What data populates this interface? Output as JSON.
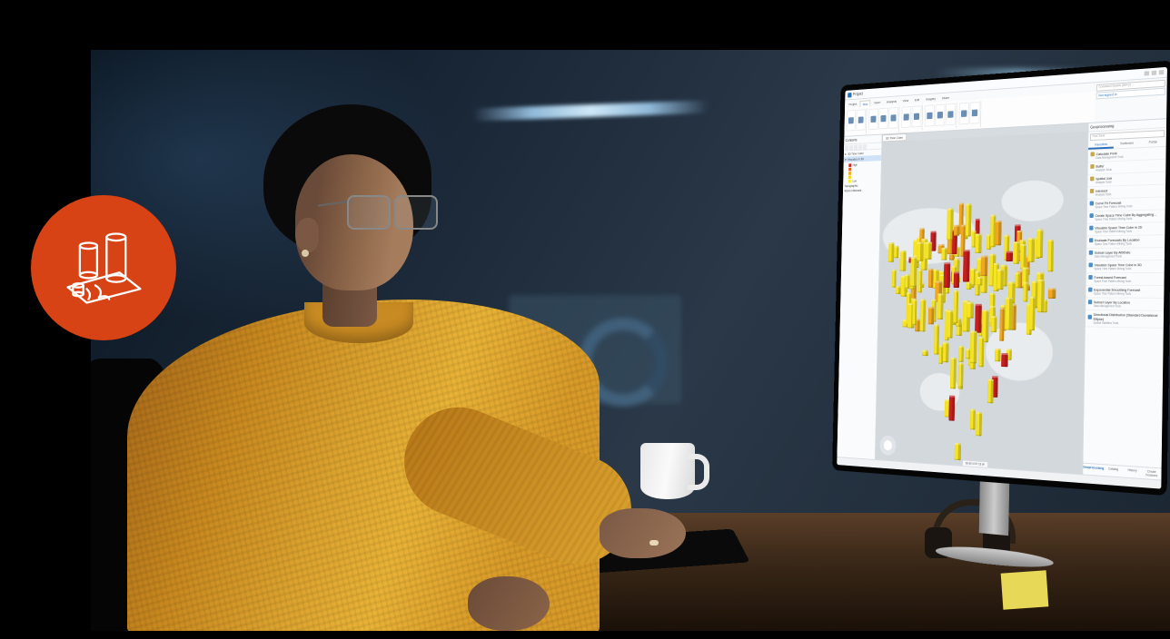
{
  "badge": {
    "color": "#d84316",
    "icon": "3d-cylinders-on-map-icon"
  },
  "monitor_app": {
    "title": "Project",
    "search_placeholder": "Command Search (Alt+Q)",
    "signin_label": "Not signed in",
    "ribbon_tabs": [
      "Project",
      "Map",
      "Insert",
      "Analysis",
      "View",
      "Edit",
      "Imagery",
      "Share"
    ],
    "active_ribbon_tab": "Map",
    "contents": {
      "title": "Contents",
      "scene_name": "3D Time Cube",
      "layer_name": "Visualize in 3D",
      "legend": [
        {
          "color": "#c81e1e",
          "label": "High"
        },
        {
          "color": "#e85a1e",
          "label": ""
        },
        {
          "color": "#f0a820",
          "label": ""
        },
        {
          "color": "#f6d824",
          "label": ""
        },
        {
          "color": "#f8f028",
          "label": "Low"
        }
      ],
      "extra_layers": [
        "Topographic",
        "World Hillshade"
      ]
    },
    "map": {
      "tab_label": "3D Time Cube",
      "coordinates": "38.05 N 97.13 W",
      "cube_colors": {
        "high": "#c81e1e",
        "mid": "#f0a820",
        "low": "#f6e424"
      }
    },
    "geoprocessing": {
      "title": "Geoprocessing",
      "search_placeholder": "Find Tools",
      "tabs": [
        "Favorites",
        "Toolboxes",
        "Portal"
      ],
      "active_tab": "Favorites",
      "tools": [
        {
          "name": "Calculate Field",
          "category": "Data Management Tools"
        },
        {
          "name": "Buffer",
          "category": "Analysis Tools"
        },
        {
          "name": "Spatial Join",
          "category": "Analysis Tools"
        },
        {
          "name": "Intersect",
          "category": "Analysis Tools"
        },
        {
          "name": "Curve Fit Forecast",
          "category": "Space Time Pattern Mining Tools"
        },
        {
          "name": "Create Space Time Cube By Aggregating…",
          "category": "Space Time Pattern Mining Tools"
        },
        {
          "name": "Visualize Space Time Cube in 2D",
          "category": "Space Time Pattern Mining Tools"
        },
        {
          "name": "Evaluate Forecasts By Location",
          "category": "Space Time Pattern Mining Tools"
        },
        {
          "name": "Subset Layer By Attribute",
          "category": "Data Management Tools"
        },
        {
          "name": "Visualize Space Time Cube in 3D",
          "category": "Space Time Pattern Mining Tools"
        },
        {
          "name": "Forest-based Forecast",
          "category": "Space Time Pattern Mining Tools"
        },
        {
          "name": "Exponential Smoothing Forecast",
          "category": "Space Time Pattern Mining Tools"
        },
        {
          "name": "Subset Layer By Location",
          "category": "Data Management Tools"
        },
        {
          "name": "Directional Distribution (Standard Deviational Ellipse)",
          "category": "Spatial Statistics Tools"
        }
      ],
      "bottom_tabs": [
        "Geoprocessing",
        "Catalog",
        "History",
        "Create Features"
      ],
      "active_bottom_tab": "Geoprocessing"
    }
  }
}
